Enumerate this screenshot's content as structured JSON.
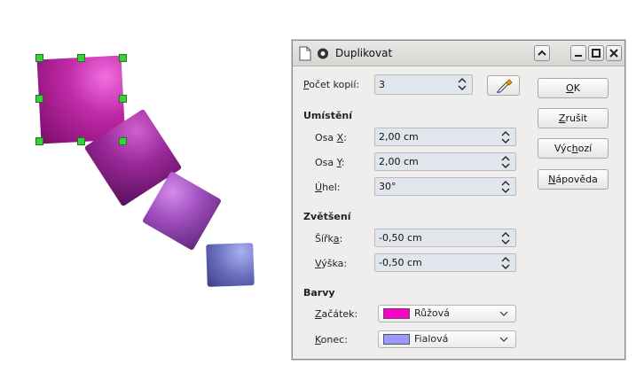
{
  "dialog": {
    "title": "Duplikovat",
    "copies": {
      "label_u": "P",
      "label_rest": "očet kopií:",
      "value": "3"
    },
    "placement": {
      "heading": "Umístění",
      "x": {
        "label_pre": "Osa ",
        "label_u": "X",
        "label_post": ":",
        "value": "2,00 cm"
      },
      "y": {
        "label_pre": "Osa ",
        "label_u": "Y",
        "label_post": ":",
        "value": "2,00 cm"
      },
      "angle": {
        "label_u": "Ú",
        "label_rest": "hel:",
        "value": "30°"
      }
    },
    "enlargement": {
      "heading": "Zvětšení",
      "width": {
        "label_pre": "Šířk",
        "label_u": "a",
        "label_post": ":",
        "value": "-0,50 cm"
      },
      "height": {
        "label_u": "V",
        "label_rest": "ýška:",
        "value": "-0,50 cm"
      }
    },
    "colors": {
      "heading": "Barvy",
      "start": {
        "label_u": "Z",
        "label_rest": "ačátek:",
        "value": "Růžová",
        "swatch": "#ff00c8"
      },
      "end": {
        "label_u": "K",
        "label_rest": "onec:",
        "value": "Fialová",
        "swatch": "#9999ff"
      }
    },
    "buttons": {
      "ok_u": "O",
      "ok_rest": "K",
      "cancel_u": "Z",
      "cancel_rest": "rušit",
      "default_pre": "Výc",
      "default_u": "h",
      "default_post": "ozí",
      "help_u": "N",
      "help_rest": "ápověda"
    }
  }
}
